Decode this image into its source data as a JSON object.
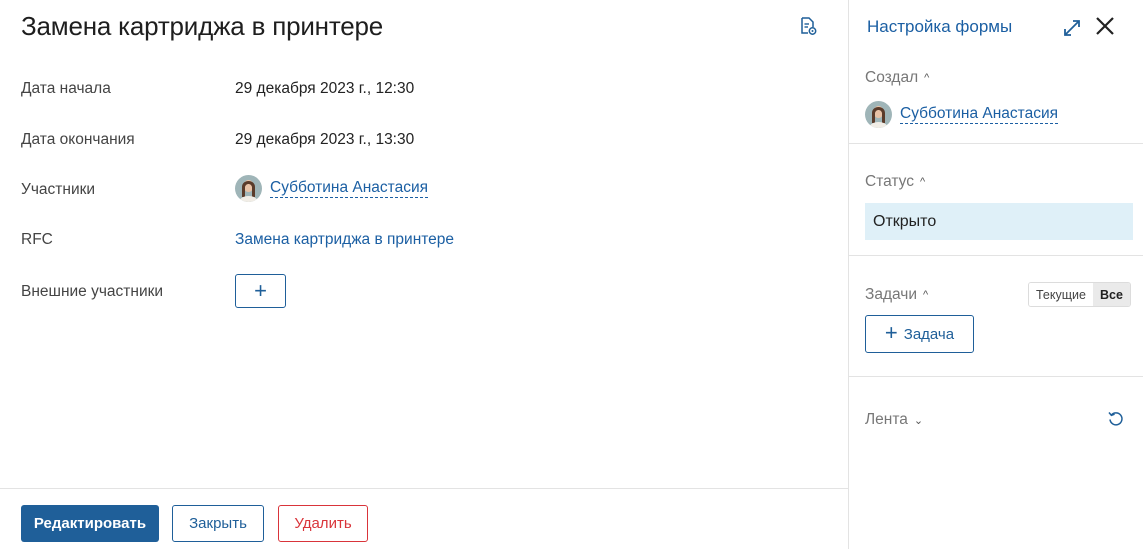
{
  "header": {
    "title": "Замена картриджа в принтере",
    "doc_icon": "document-settings-icon"
  },
  "fields": [
    {
      "label": "Дата начала",
      "value": "29 декабря 2023 г., 12:30"
    },
    {
      "label": "Дата окончания",
      "value": "29 декабря 2023 г., 13:30"
    },
    {
      "label": "Участники",
      "value": "Субботина Анастасия"
    },
    {
      "label": "RFC",
      "value": "Замена картриджа в принтере"
    },
    {
      "label": "Внешние участники",
      "value": "+"
    }
  ],
  "footer": {
    "edit_label": "Редактировать",
    "close_label": "Закрыть",
    "delete_label": "Удалить"
  },
  "sidebar": {
    "form_settings": "Настройка формы",
    "creator": {
      "title": "Создал",
      "name": "Субботина Анастасия"
    },
    "status": {
      "title": "Статус",
      "value": "Открыто"
    },
    "tasks": {
      "title": "Задачи",
      "toggle_current": "Текущие",
      "toggle_all": "Все",
      "add_label": "Задача"
    },
    "feed": {
      "title": "Лента"
    }
  },
  "colors": {
    "accent": "#1f5f99",
    "link": "#1b5fa3",
    "danger": "#d9343a",
    "status_bg": "#dff0f8"
  }
}
